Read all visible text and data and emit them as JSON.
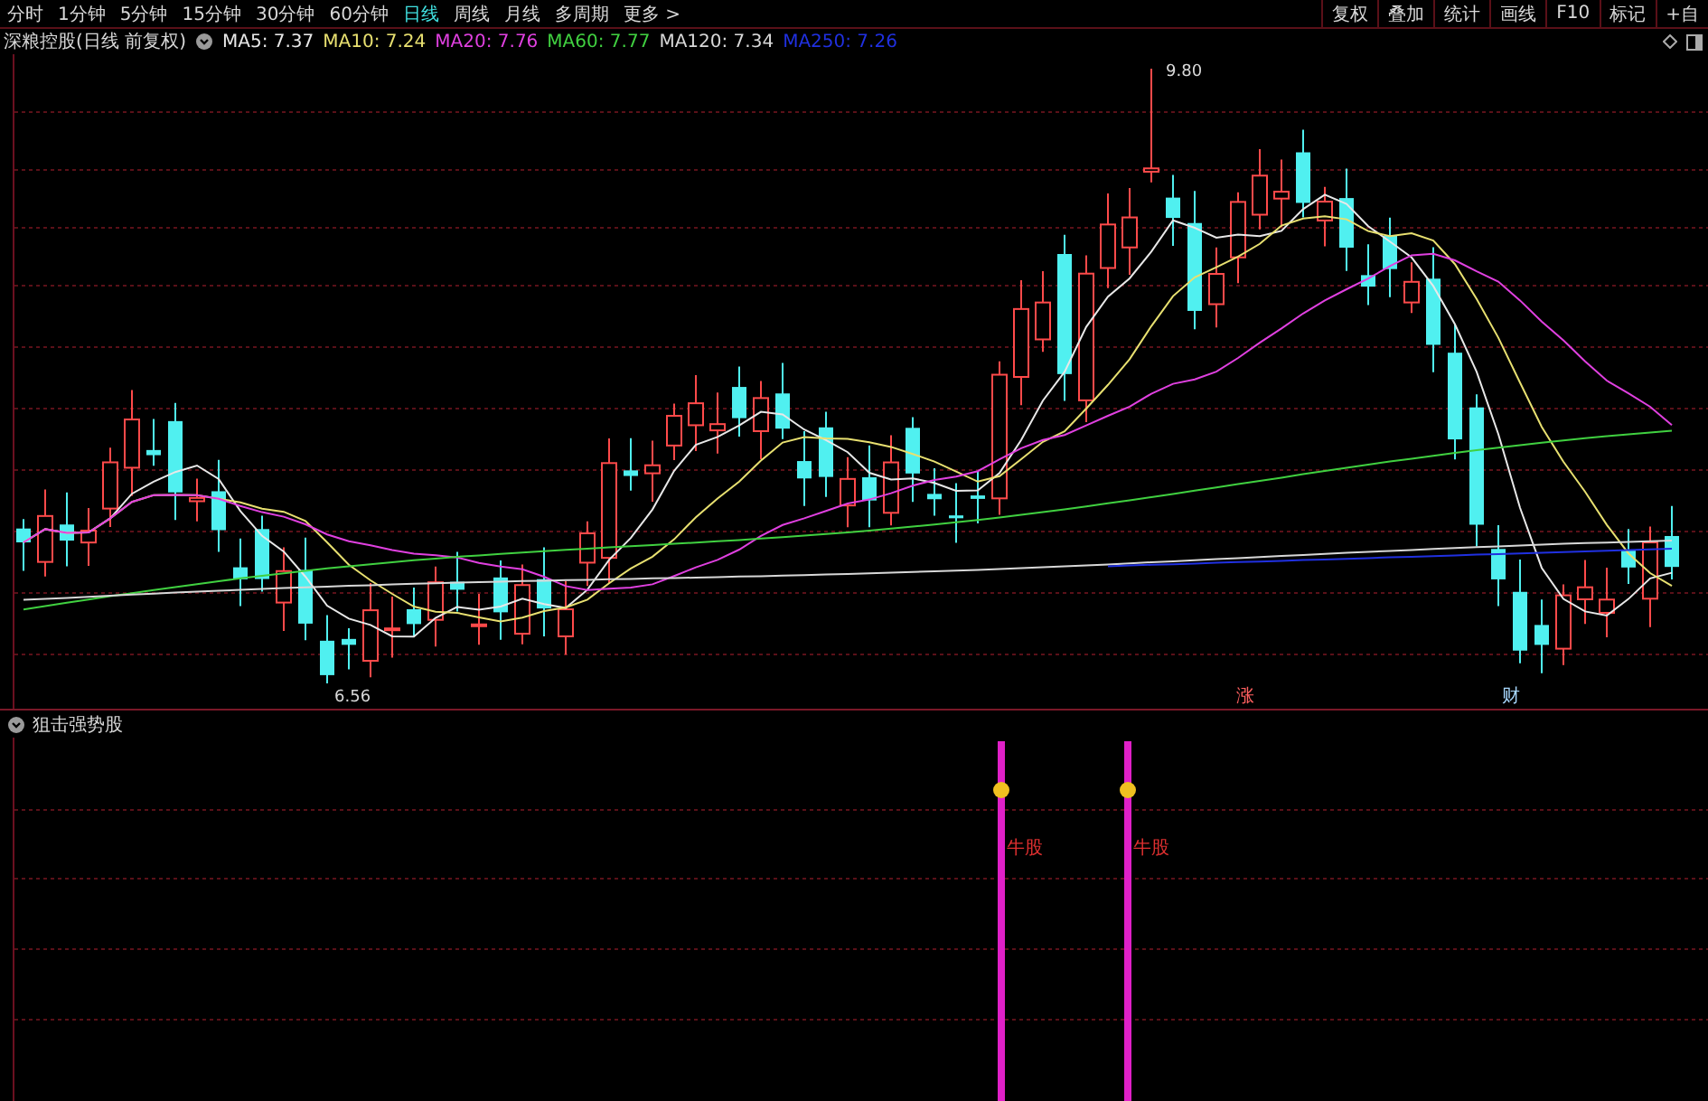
{
  "toolbar": {
    "periods": [
      {
        "label": "分时",
        "selected": false
      },
      {
        "label": "1分钟",
        "selected": false
      },
      {
        "label": "5分钟",
        "selected": false
      },
      {
        "label": "15分钟",
        "selected": false
      },
      {
        "label": "30分钟",
        "selected": false
      },
      {
        "label": "60分钟",
        "selected": false
      },
      {
        "label": "日线",
        "selected": true
      },
      {
        "label": "周线",
        "selected": false
      },
      {
        "label": "月线",
        "selected": false
      },
      {
        "label": "多周期",
        "selected": false
      },
      {
        "label": "更多 >",
        "selected": false
      }
    ],
    "buttons": [
      "复权",
      "叠加",
      "统计",
      "画线",
      "F10",
      "标记",
      "+自"
    ]
  },
  "info": {
    "title": "深粮控股(日线 前复权)",
    "moving_averages": [
      {
        "label": "MA5: 7.37",
        "color": "#e8e8e8"
      },
      {
        "label": "MA10: 7.24",
        "color": "#e8e070"
      },
      {
        "label": "MA20: 7.76",
        "color": "#e040e0"
      },
      {
        "label": "MA60: 7.77",
        "color": "#40d040"
      },
      {
        "label": "MA120: 7.34",
        "color": "#d8d8d8"
      },
      {
        "label": "MA250: 7.26",
        "color": "#2030e0"
      }
    ]
  },
  "price_chart": {
    "high_label": "9.80",
    "low_label": "6.56",
    "markers": [
      {
        "text": "涨",
        "color": "#ff6060"
      },
      {
        "text": "财",
        "color": "#a8d8ff"
      }
    ]
  },
  "indicator": {
    "title": "狙击强势股",
    "signals": [
      {
        "label": "牛股"
      },
      {
        "label": "牛股"
      }
    ]
  }
}
